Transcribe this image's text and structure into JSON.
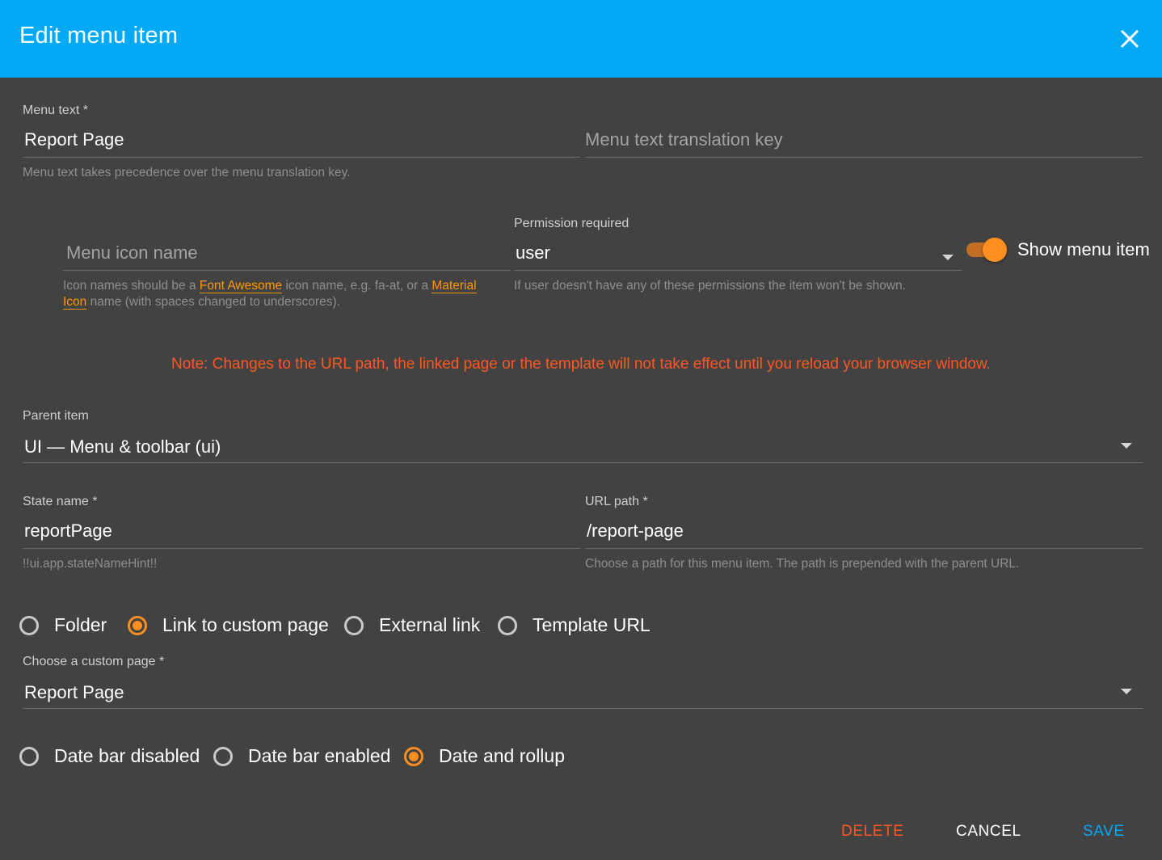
{
  "dialog": {
    "title": "Edit menu item"
  },
  "menu_text": {
    "label": "Menu text *",
    "value": "Report Page",
    "hint": "Menu text takes precedence over the menu translation key."
  },
  "translation_key": {
    "placeholder": "Menu text translation key"
  },
  "icon": {
    "placeholder": "Menu icon name",
    "hint_part1": "Icon names should be a ",
    "hint_link1": "Font Awesome",
    "hint_part2": " icon name, e.g. fa-at, or a ",
    "hint_link2a": "Material",
    "hint_link2b": "Icon",
    "hint_part3": " name (with spaces changed to underscores)."
  },
  "permission": {
    "label": "Permission required",
    "value": "user",
    "hint": "If user doesn't have any of these permissions the item won't be shown."
  },
  "show_menu_item": {
    "label": "Show menu item",
    "checked": true
  },
  "note": "Note: Changes to the URL path, the linked page or the template will not take effect until you reload your browser window.",
  "parent_item": {
    "label": "Parent item",
    "value": "UI — Menu & toolbar (ui)"
  },
  "state_name": {
    "label": "State name *",
    "value": "reportPage",
    "hint": "!!ui.app.stateNameHint!!"
  },
  "url_path": {
    "label": "URL path *",
    "value": "/report-page",
    "hint": "Choose a path for this menu item. The path is prepended with the parent URL."
  },
  "link_type": {
    "options": [
      "Folder",
      "Link to custom page",
      "External link",
      "Template URL"
    ],
    "selected": "Link to custom page"
  },
  "custom_page": {
    "label": "Choose a custom page *",
    "value": "Report Page"
  },
  "date_bar": {
    "options": [
      "Date bar disabled",
      "Date bar enabled",
      "Date and rollup"
    ],
    "selected": "Date and rollup"
  },
  "actions": {
    "delete": "DELETE",
    "cancel": "CANCEL",
    "save": "SAVE"
  },
  "colors": {
    "header": "#03a9f4",
    "background": "#424242",
    "accent": "#ff8f1f",
    "warn": "#ff5722",
    "primary": "#03a9f4"
  },
  "icons": {
    "close": "close-icon",
    "dropdown": "chevron-down-icon"
  }
}
